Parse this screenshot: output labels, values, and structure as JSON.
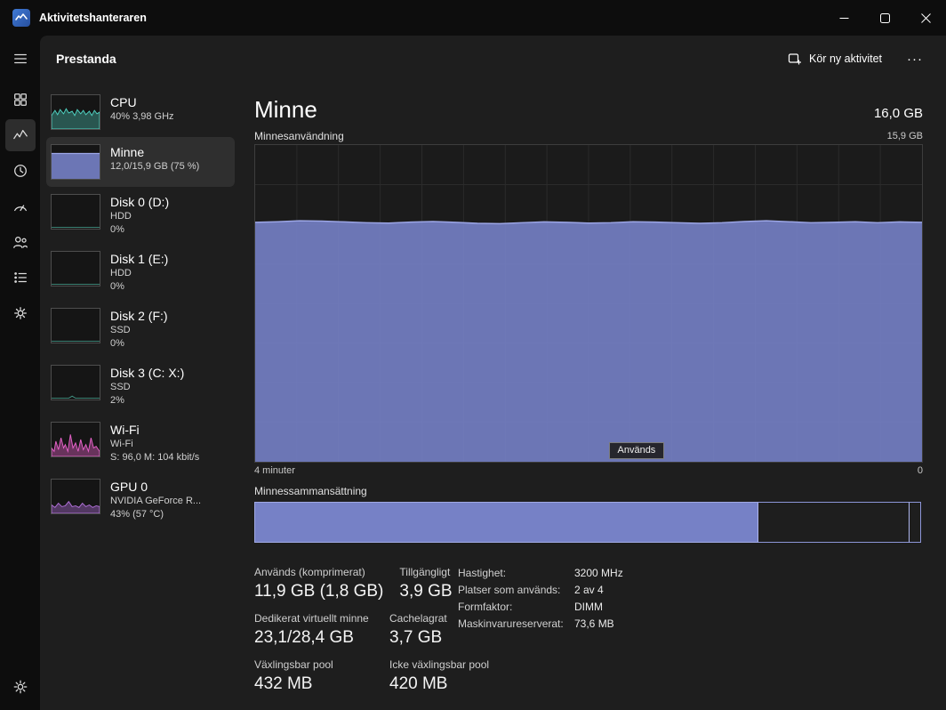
{
  "window": {
    "title": "Aktivitetshanteraren"
  },
  "window_controls": {
    "minimize": "minimize",
    "maximize": "maximize",
    "close": "close"
  },
  "header": {
    "title": "Prestanda",
    "run_new_task_label": "Kör ny aktivitet",
    "more_label": "···"
  },
  "colors": {
    "memory_fill": "#7681c6",
    "memory_stroke": "#9ca6e6",
    "cpu_teal": "#4fd1c0",
    "wifi_pink": "#e561c8",
    "gpu_purple": "#b06fd8",
    "selected_bg": "#2f2f2f",
    "page_bg": "#1e1e1e"
  },
  "perf_items": [
    {
      "name": "CPU",
      "lines": [
        "40% 3,98 GHz"
      ]
    },
    {
      "name": "Minne",
      "lines": [
        "12,0/15,9 GB (75 %)"
      ],
      "selected": true
    },
    {
      "name": "Disk 0 (D:)",
      "lines": [
        "HDD",
        "0%"
      ]
    },
    {
      "name": "Disk 1 (E:)",
      "lines": [
        "HDD",
        "0%"
      ]
    },
    {
      "name": "Disk 2 (F:)",
      "lines": [
        "SSD",
        "0%"
      ]
    },
    {
      "name": "Disk 3 (C: X:)",
      "lines": [
        "SSD",
        "2%"
      ]
    },
    {
      "name": "Wi-Fi",
      "lines": [
        "Wi-Fi",
        "S: 96,0 M: 104 kbit/s"
      ]
    },
    {
      "name": "GPU 0",
      "lines": [
        "NVIDIA GeForce R...",
        "43% (57 °C)"
      ]
    }
  ],
  "main": {
    "title": "Minne",
    "capacity": "16,0 GB",
    "usage_chart_label": "Minnesanvändning",
    "usage_chart_max": "15,9 GB",
    "x_axis_left": "4 minuter",
    "x_axis_right": "0",
    "tooltip": "Används",
    "composition_label": "Minnessammansättning",
    "composition_segments": [
      {
        "name": "in-use",
        "pct": 75.4,
        "filled": true
      },
      {
        "name": "standby",
        "pct": 22.8,
        "filled": false
      },
      {
        "name": "free",
        "pct": 1.8,
        "filled": false
      }
    ],
    "stats_rows": [
      [
        {
          "label": "Används (komprimerat)",
          "value": "11,9 GB (1,8 GB)"
        },
        {
          "label": "Tillgängligt",
          "value": "3,9 GB"
        }
      ],
      [
        {
          "label": "Dedikerat virtuellt minne",
          "value": "23,1/28,4 GB"
        },
        {
          "label": "Cachelagrat",
          "value": "3,7 GB"
        }
      ],
      [
        {
          "label": "Växlingsbar pool",
          "value": "432 MB"
        },
        {
          "label": "Icke växlingsbar pool",
          "value": "420 MB"
        }
      ]
    ],
    "details": [
      {
        "label": "Hastighet:",
        "value": "3200 MHz"
      },
      {
        "label": "Platser som används:",
        "value": "2 av 4"
      },
      {
        "label": "Formfaktor:",
        "value": "DIMM"
      },
      {
        "label": "Maskinvarureserverat:",
        "value": "73,6 MB"
      }
    ]
  },
  "chart_data": {
    "type": "area",
    "title": "Minnesanvändning",
    "unit": "GB",
    "ylim": [
      0,
      15.9
    ],
    "x_axis": {
      "left_label": "4 minuter",
      "right_label": "0"
    },
    "grid": {
      "v_lines": 16,
      "h_lines": 8
    },
    "series": [
      {
        "name": "Används",
        "values": [
          12.02,
          12.05,
          12.1,
          12.08,
          12.04,
          12.0,
          11.98,
          12.03,
          12.06,
          12.02,
          11.97,
          11.95,
          12.0,
          12.04,
          12.02,
          11.98,
          12.0,
          12.05,
          12.03,
          12.0,
          11.97,
          12.0,
          12.06,
          12.1,
          12.05,
          12.0,
          12.02,
          12.05,
          12.0,
          12.04,
          12.02
        ]
      }
    ]
  }
}
